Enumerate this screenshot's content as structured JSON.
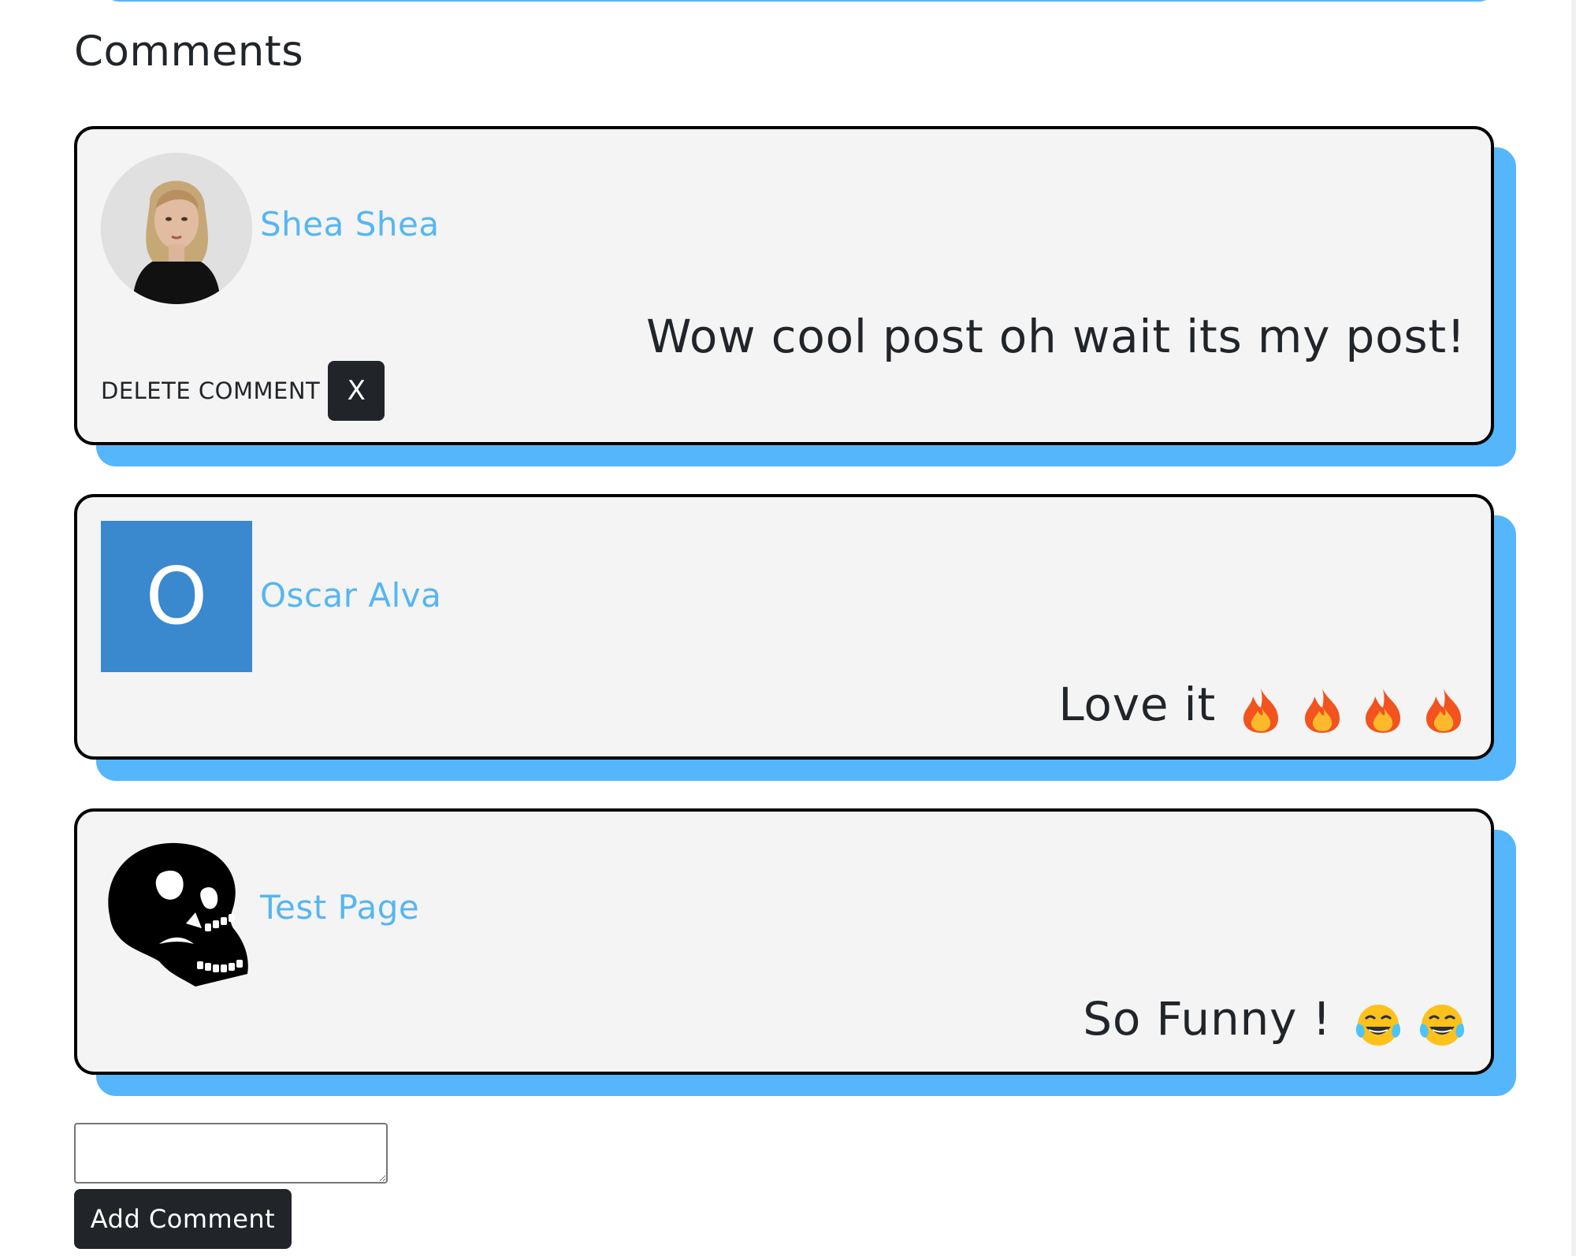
{
  "section": {
    "title": "Comments"
  },
  "comments": [
    {
      "author": "Shea Shea",
      "avatar": "profile-photo",
      "text": "Wow cool post oh wait its my post!",
      "emojis": [],
      "delete_label": "DELETE COMMENT",
      "delete_button": "X"
    },
    {
      "author": "Oscar Alva",
      "avatar": "letter-avatar",
      "avatar_letter": "O",
      "avatar_color": "#3a88ce",
      "text": "Love it",
      "emojis": [
        "fire-icon",
        "fire-icon",
        "fire-icon",
        "fire-icon"
      ]
    },
    {
      "author": "Test Page",
      "avatar": "skull-icon",
      "text": "So Funny !",
      "emojis": [
        "tears-of-joy-icon",
        "tears-of-joy-icon"
      ]
    }
  ],
  "new_comment": {
    "value": "",
    "button_label": "Add Comment"
  },
  "colors": {
    "accent_shadow": "#56b6fb",
    "link": "#56b6f1",
    "card_bg": "#f4f4f4",
    "dark_button": "#212529"
  }
}
